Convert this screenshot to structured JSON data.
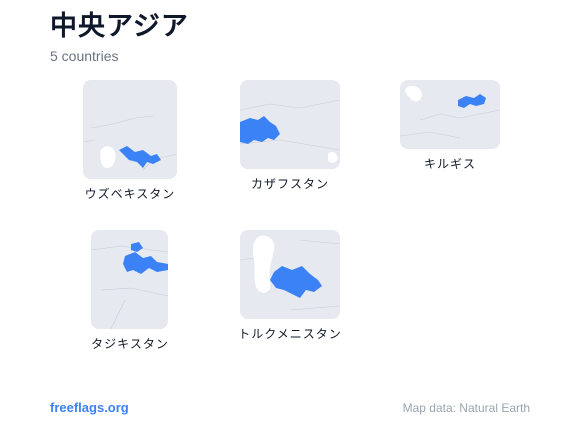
{
  "page": {
    "title": "中央アジア",
    "subtitle": "5 countries"
  },
  "countries": [
    {
      "name": "ウズベキスタン"
    },
    {
      "name": "カザフスタン"
    },
    {
      "name": "キルギス"
    },
    {
      "name": "タジキスタン"
    },
    {
      "name": "トルクメニスタン"
    }
  ],
  "colors": {
    "highlight": "#3b82f6",
    "land": "#e6e9ef",
    "water": "#ffffff"
  },
  "footer": {
    "brand": "freeflags.org",
    "credit": "Map data: Natural Earth"
  }
}
